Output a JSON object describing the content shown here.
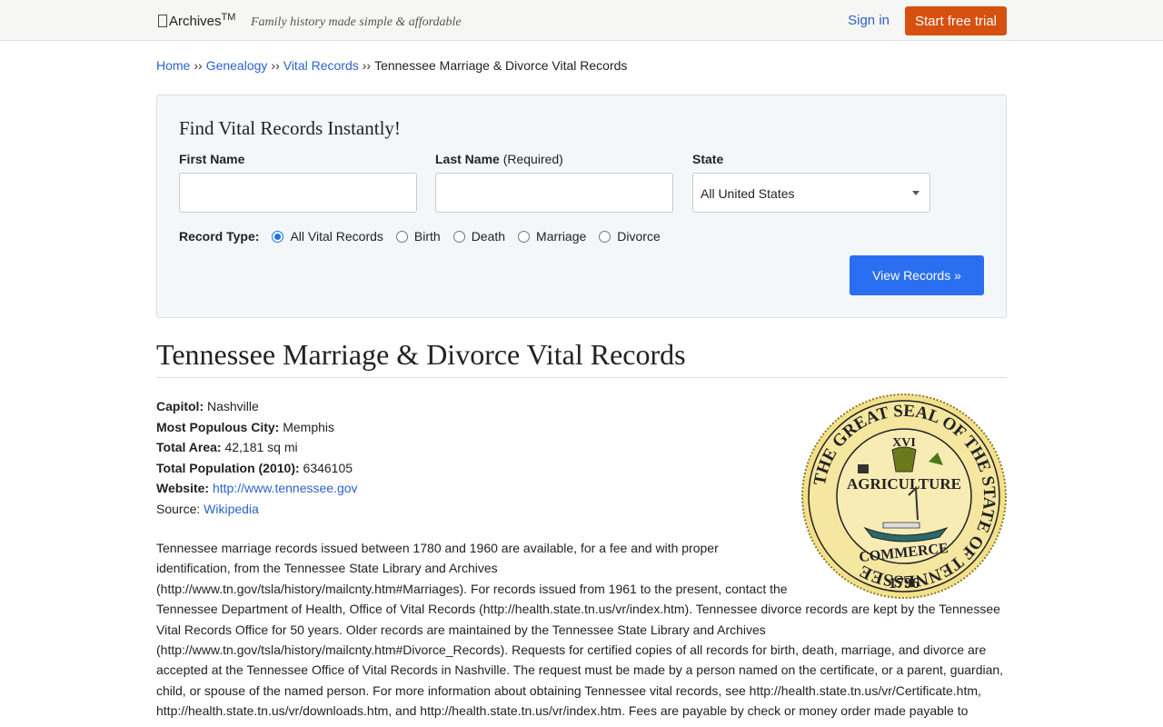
{
  "header": {
    "logo_text": "Archives",
    "logo_tm": "TM",
    "tagline": "Family history made simple & affordable",
    "signin": "Sign in",
    "trial_button": "Start free trial",
    "trial_color": "#d6500f"
  },
  "breadcrumb": {
    "items": [
      "Home",
      "Genealogy",
      "Vital Records"
    ],
    "separator": "››",
    "current": "Tennessee Marriage & Divorce Vital Records"
  },
  "search": {
    "title": "Find Vital Records Instantly!",
    "first_name_label": "First Name",
    "last_name_label": "Last Name",
    "last_name_required": "(Required)",
    "state_label": "State",
    "first_name_value": "",
    "last_name_value": "",
    "state_value": "All United States",
    "record_type_label": "Record Type:",
    "record_types": [
      "All Vital Records",
      "Birth",
      "Death",
      "Marriage",
      "Divorce"
    ],
    "selected_record_type": "All Vital Records",
    "submit": "View Records »",
    "submit_color": "#2a6ef2"
  },
  "page": {
    "title": "Tennessee Marriage & Divorce Vital Records",
    "facts": {
      "capitol_label": "Capitol:",
      "capitol": "Nashville",
      "city_label": "Most Populous City:",
      "city": "Memphis",
      "area_label": "Total Area:",
      "area": "42,181 sq mi",
      "population_label": "Total Population (2010):",
      "population": "6346105",
      "website_label": "Website:",
      "website": "http://www.tennessee.gov",
      "source_label": "Source:",
      "source": "Wikipedia"
    },
    "seal": {
      "ring_text": "THE GREAT SEAL OF THE STATE OF TENNESSEE",
      "numeral": "XVI",
      "top_word": "AGRICULTURE",
      "bottom_word": "COMMERCE",
      "year": "1796",
      "color": "#f3e08a"
    },
    "paragraph": "Tennessee marriage records issued between 1780 and 1960 are available, for a fee and with proper identification, from the Tennessee State Library and Archives (http://www.tn.gov/tsla/history/mailcnty.htm#Marriages). For records issued from 1961 to the present, contact the Tennessee Department of Health, Office of Vital Records (http://health.state.tn.us/vr/index.htm). Tennessee divorce records are kept by the Tennessee Vital Records Office for 50 years. Older records are maintained by the Tennessee State Library and Archives (http://www.tn.gov/tsla/history/mailcnty.htm#Divorce_Records). Requests for certified copies of all records for birth, death, marriage, and divorce are accepted at the Tennessee Office of Vital Records in Nashville. The request must be made by a person named on the certificate, or a parent, guardian, child, or spouse of the named person. For more information about obtaining Tennessee vital records, see http://health.state.tn.us/vr/Certificate.htm, http://health.state.tn.us/vr/downloads.htm, and http://health.state.tn.us/vr/index.htm. Fees are payable by check or money order made payable to Tennessee Vital Records, or credit card."
  }
}
